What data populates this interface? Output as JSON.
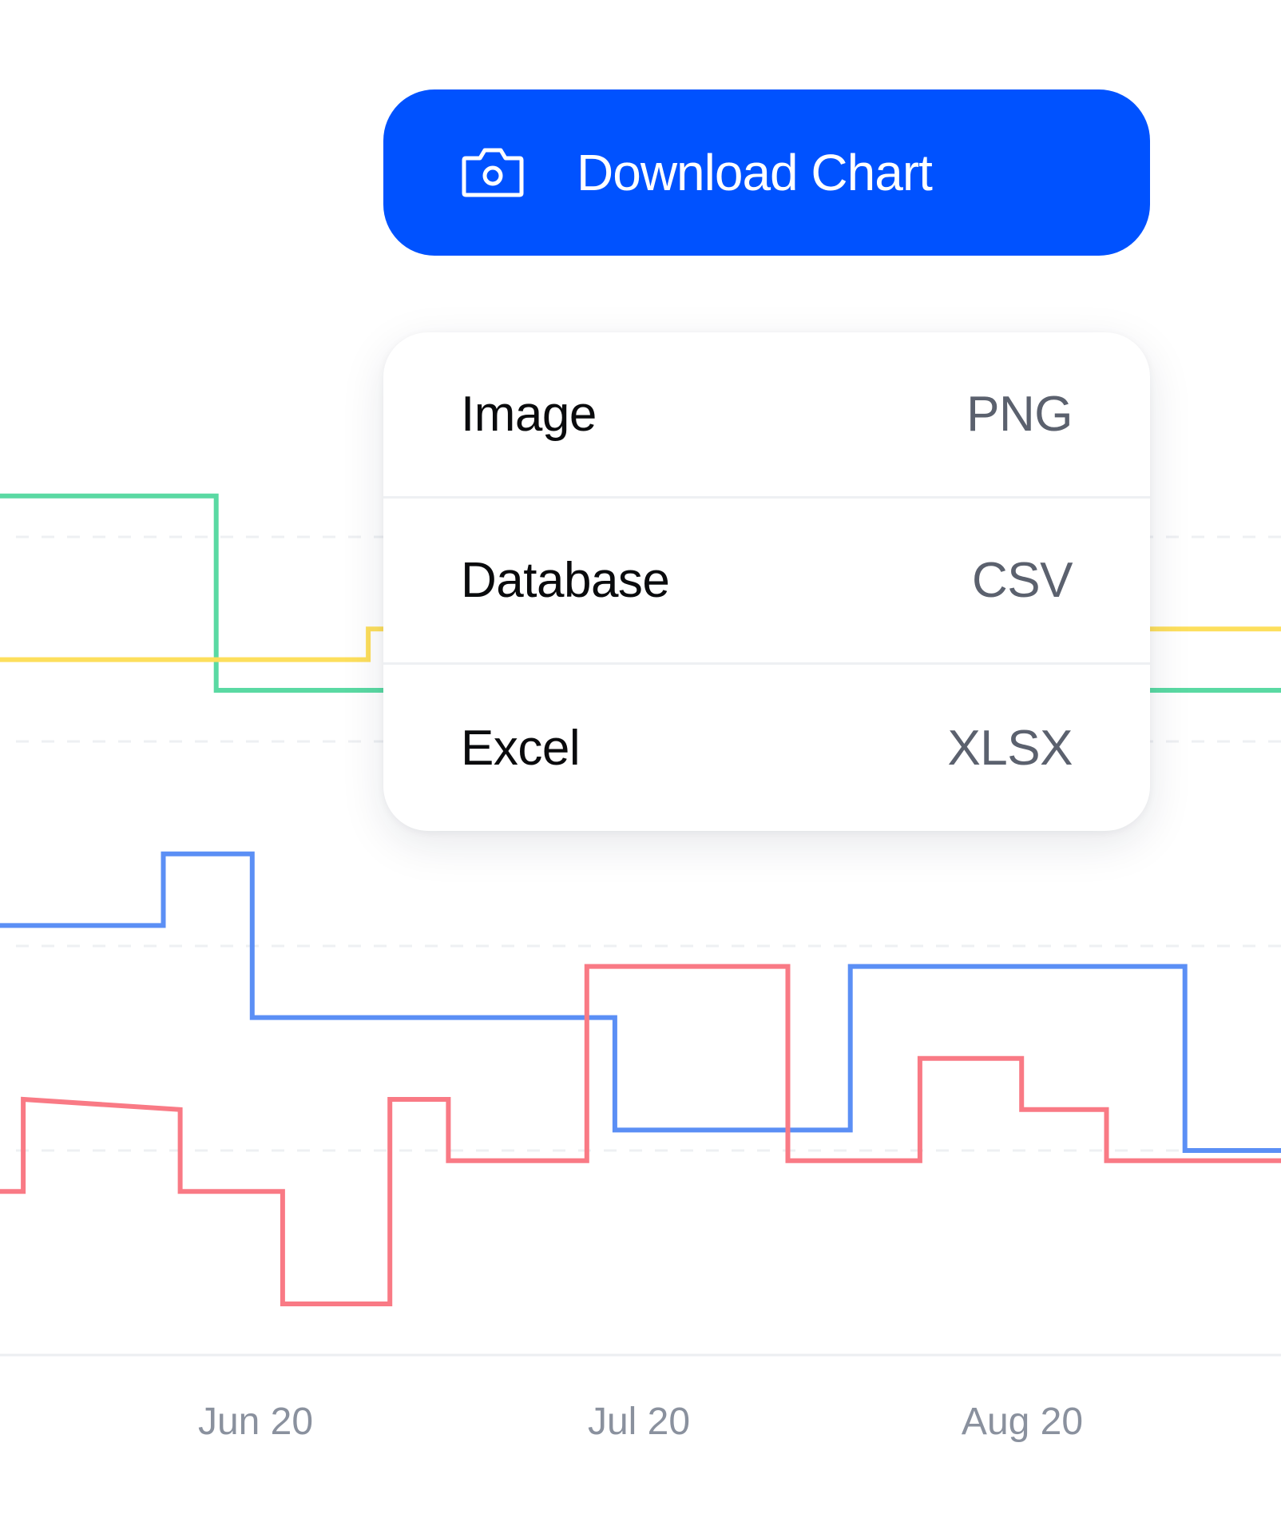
{
  "download_button": {
    "label": "Download Chart",
    "icon": "camera-icon",
    "color": "#0052ff"
  },
  "export_menu": {
    "items": [
      {
        "name": "Image",
        "format": "PNG"
      },
      {
        "name": "Database",
        "format": "CSV"
      },
      {
        "name": "Excel",
        "format": "XLSX"
      }
    ]
  },
  "chart_data": {
    "type": "line",
    "step": true,
    "title": "",
    "xlabel": "",
    "ylabel": "",
    "x_tick_labels": [
      "Jun 20",
      "Jul 20",
      "Aug 20"
    ],
    "grid": true,
    "series": [
      {
        "color": "#5ad9a3",
        "points": [
          [
            0,
            84
          ],
          [
            270,
            84
          ],
          [
            270,
            65
          ],
          [
            480,
            65
          ],
          [
            1600,
            65
          ]
        ]
      },
      {
        "color": "#fddf5c",
        "points": [
          [
            0,
            68
          ],
          [
            460,
            68
          ],
          [
            460,
            71
          ],
          [
            1600,
            71
          ]
        ]
      },
      {
        "color": "#5b8ff5",
        "points": [
          [
            0,
            42
          ],
          [
            204,
            42
          ],
          [
            204,
            49
          ],
          [
            315,
            49
          ],
          [
            315,
            33
          ],
          [
            768,
            33
          ],
          [
            768,
            22
          ],
          [
            1062,
            22
          ],
          [
            1062,
            38
          ],
          [
            1480,
            38
          ],
          [
            1480,
            20
          ],
          [
            1600,
            20
          ]
        ]
      },
      {
        "color": "#f97a85",
        "points": [
          [
            0,
            16
          ],
          [
            29,
            16
          ],
          [
            29,
            25
          ],
          [
            225,
            24
          ],
          [
            225,
            16
          ],
          [
            353,
            16
          ],
          [
            353,
            5
          ],
          [
            487,
            5
          ],
          [
            487,
            25
          ],
          [
            560,
            25
          ],
          [
            560,
            19
          ],
          [
            733,
            19
          ],
          [
            733,
            38
          ],
          [
            984,
            38
          ],
          [
            984,
            19
          ],
          [
            1149,
            19
          ],
          [
            1149,
            29
          ],
          [
            1276,
            29
          ],
          [
            1276,
            24
          ],
          [
            1382,
            24
          ],
          [
            1382,
            19
          ],
          [
            1600,
            19
          ]
        ]
      }
    ]
  }
}
